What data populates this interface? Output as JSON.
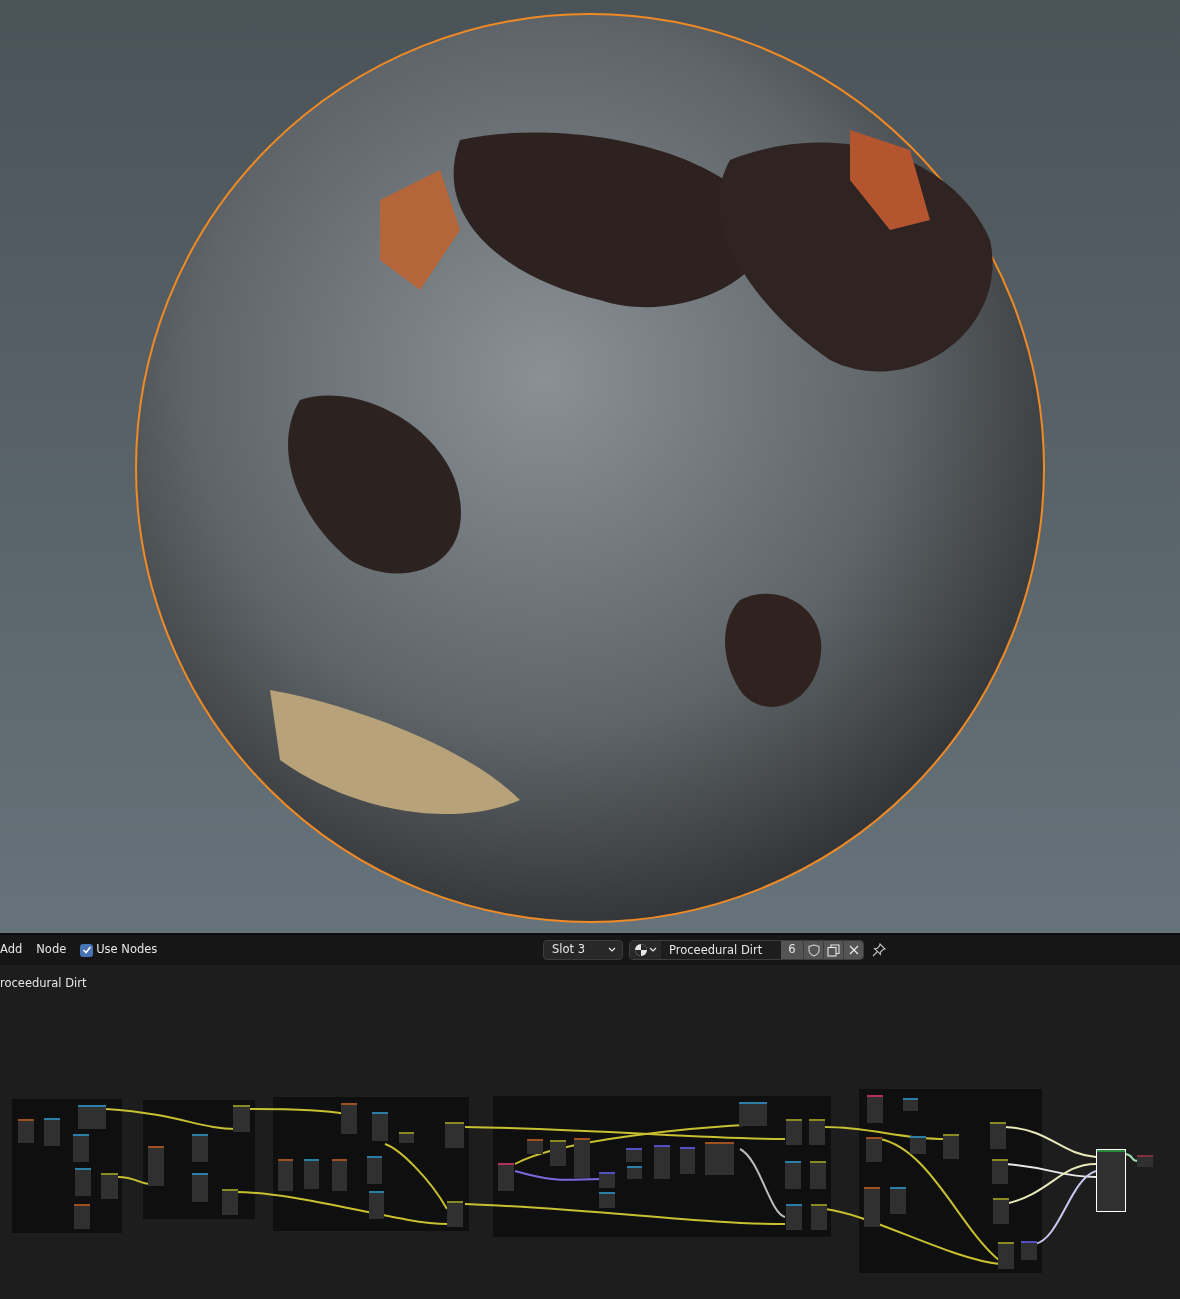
{
  "menu": [
    {
      "label": "Add"
    },
    {
      "label": "Node"
    }
  ],
  "use_nodes": {
    "label": "Use Nodes",
    "checked": true
  },
  "slot": {
    "value": "Slot 3"
  },
  "material": {
    "name": "Proceedural Dirt",
    "users": "6"
  },
  "breadcrumb": "roceedural Dirt"
}
